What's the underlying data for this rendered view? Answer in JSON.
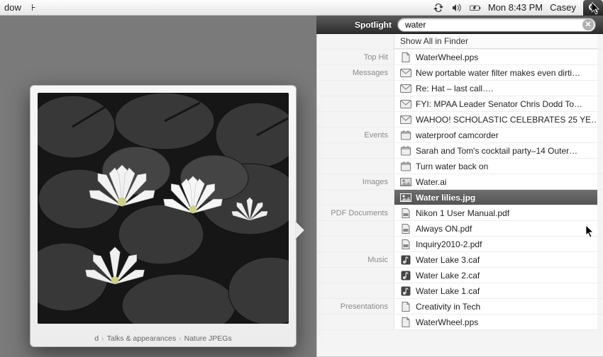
{
  "menubar": {
    "left_items": [
      "dow",
      "⊦"
    ],
    "clock": "Mon 8:43 PM",
    "user": "Casey"
  },
  "spotlight": {
    "title": "Spotlight",
    "query": "water",
    "show_all_label": "Show All in Finder",
    "sections": [
      {
        "name": "Top Hit",
        "items": [
          {
            "icon": "doc",
            "label": "WaterWheel.pps"
          }
        ]
      },
      {
        "name": "Messages",
        "items": [
          {
            "icon": "mail",
            "label": "New portable water filter makes even dirti…"
          },
          {
            "icon": "mail",
            "label": "Re: Hat – last call…."
          },
          {
            "icon": "mail",
            "label": "FYI: MPAA Leader Senator Chris Dodd To…"
          },
          {
            "icon": "mail",
            "label": "WAHOO! SCHOLASTIC CELEBRATES 25 YE…"
          }
        ]
      },
      {
        "name": "Events",
        "items": [
          {
            "icon": "cal",
            "label": "waterproof camcorder"
          },
          {
            "icon": "cal",
            "label": "Sarah and Tom's cocktail party–14 Outer…"
          },
          {
            "icon": "cal",
            "label": "Turn water back on"
          }
        ]
      },
      {
        "name": "Images",
        "items": [
          {
            "icon": "img",
            "label": "Water.ai"
          },
          {
            "icon": "img",
            "label": "Water lilies.jpg",
            "selected": true
          }
        ]
      },
      {
        "name": "PDF Documents",
        "items": [
          {
            "icon": "pdf",
            "label": "Nikon 1 User Manual.pdf"
          },
          {
            "icon": "pdf",
            "label": "Always ON.pdf"
          },
          {
            "icon": "pdf",
            "label": "Inquiry2010-2.pdf"
          }
        ]
      },
      {
        "name": "Music",
        "items": [
          {
            "icon": "audio",
            "label": "Water Lake 3.caf"
          },
          {
            "icon": "audio",
            "label": "Water Lake 2.caf"
          },
          {
            "icon": "audio",
            "label": "Water Lake 1.caf"
          }
        ]
      },
      {
        "name": "Presentations",
        "items": [
          {
            "icon": "doc",
            "label": "Creativity in Tech"
          },
          {
            "icon": "doc",
            "label": "WaterWheel.pps"
          }
        ]
      }
    ]
  },
  "preview": {
    "crumbs": [
      "d",
      "Talks & appearances",
      "Nature JPEGs"
    ]
  }
}
